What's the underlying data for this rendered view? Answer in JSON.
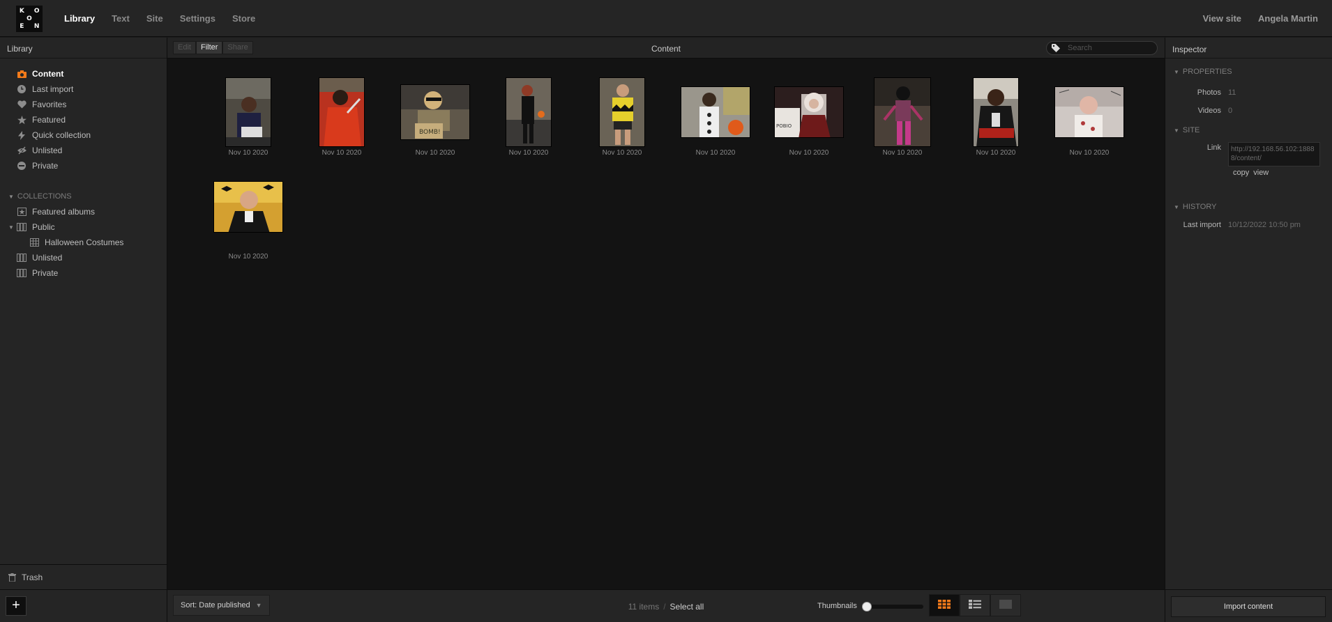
{
  "logo": {
    "letters": [
      "K",
      "",
      "O",
      "",
      "O",
      "",
      "E",
      "",
      "N"
    ]
  },
  "topnav": {
    "items": [
      {
        "label": "Library",
        "active": true
      },
      {
        "label": "Text",
        "active": false
      },
      {
        "label": "Site",
        "active": false
      },
      {
        "label": "Settings",
        "active": false
      },
      {
        "label": "Store",
        "active": false
      }
    ],
    "view_site": "View site",
    "user": "Angela Martin"
  },
  "sidebar": {
    "title": "Library",
    "items": [
      {
        "label": "Content",
        "icon": "camera-icon",
        "active": true
      },
      {
        "label": "Last import",
        "icon": "clock-icon"
      },
      {
        "label": "Favorites",
        "icon": "heart-icon"
      },
      {
        "label": "Featured",
        "icon": "star-icon"
      },
      {
        "label": "Quick collection",
        "icon": "bolt-icon"
      },
      {
        "label": "Unlisted",
        "icon": "hidden-eye-icon"
      },
      {
        "label": "Private",
        "icon": "private-icon"
      }
    ],
    "collections_label": "COLLECTIONS",
    "collections": {
      "featured_albums": "Featured albums",
      "public": "Public",
      "halloween": "Halloween Costumes",
      "unlisted": "Unlisted",
      "private": "Private"
    },
    "trash": "Trash",
    "add": "+"
  },
  "toolbar": {
    "edit": "Edit",
    "filter": "Filter",
    "share": "Share",
    "title": "Content",
    "search_placeholder": "Search"
  },
  "thumbnails": [
    {
      "date": "Nov 10 2020",
      "bg": "#5a5347"
    },
    {
      "date": "Nov 10 2020",
      "bg": "#c2321c"
    },
    {
      "date": "Nov 10 2020",
      "bg": "#6c6048"
    },
    {
      "date": "Nov 10 2020",
      "bg": "#56504a"
    },
    {
      "date": "Nov 10 2020",
      "bg": "#b7a636"
    },
    {
      "date": "Nov 10 2020",
      "bg": "#7f7a6f"
    },
    {
      "date": "Nov 10 2020",
      "bg": "#3f2b2a"
    },
    {
      "date": "Nov 10 2020",
      "bg": "#5a3a4a"
    },
    {
      "date": "Nov 10 2020",
      "bg": "#5f5a58"
    },
    {
      "date": "Nov 10 2020",
      "bg": "#b8aeae"
    },
    {
      "date": "Nov 10 2020",
      "bg": "#8a6a2a"
    }
  ],
  "footer": {
    "sort": "Sort: Date published",
    "count": "11 items",
    "divider": "/",
    "select_all": "Select all",
    "thumbnails_label": "Thumbnails",
    "thumbnail_size": 0
  },
  "inspector": {
    "title": "Inspector",
    "properties_label": "PROPERTIES",
    "photos_label": "Photos",
    "photos": "11",
    "videos_label": "Videos",
    "videos": "0",
    "site_label": "SITE",
    "link_label": "Link",
    "link": "http://192.168.56.102:18888/content/",
    "copy": "copy",
    "view": "view",
    "history_label": "HISTORY",
    "last_import_label": "Last import",
    "last_import": "10/12/2022 10:50 pm",
    "import_button": "Import content"
  },
  "colors": {
    "accent": "#f27a1a"
  }
}
